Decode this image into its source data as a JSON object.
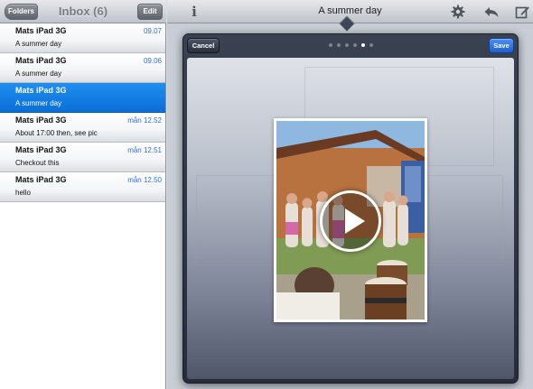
{
  "inbox": {
    "folders_label": "Folders",
    "title": "Inbox (6)",
    "edit_label": "Edit",
    "messages": [
      {
        "sender": "Mats iPad 3G",
        "time": "09.07",
        "preview": "A summer day",
        "selected": false
      },
      {
        "sender": "Mats iPad 3G",
        "time": "09.06",
        "preview": "A summer day",
        "selected": false
      },
      {
        "sender": "Mats iPad 3G",
        "time": "",
        "preview": "A summer day",
        "selected": true
      },
      {
        "sender": "Mats iPad 3G",
        "time": "mån 12.52",
        "preview": "About 17:00 then, see pic",
        "selected": false
      },
      {
        "sender": "Mats iPad 3G",
        "time": "mån 12.51",
        "preview": "Checkout this",
        "selected": false
      },
      {
        "sender": "Mats iPad 3G",
        "time": "mån 12.50",
        "preview": "hello",
        "selected": false
      }
    ]
  },
  "detail": {
    "title": "A summer day",
    "icons": [
      "info-icon",
      "gear-icon",
      "reply-icon",
      "compose-icon"
    ]
  },
  "modal": {
    "cancel_label": "Cancel",
    "save_label": "Save",
    "page_count": 6,
    "active_page": 5,
    "media": {
      "type": "video",
      "icon": "play-icon"
    }
  },
  "colors": {
    "accent_blue": "#0b6fd8",
    "time_blue": "#2f6ed8",
    "save_blue": "#1f5fd0",
    "modal_dark": "#2e3544"
  }
}
